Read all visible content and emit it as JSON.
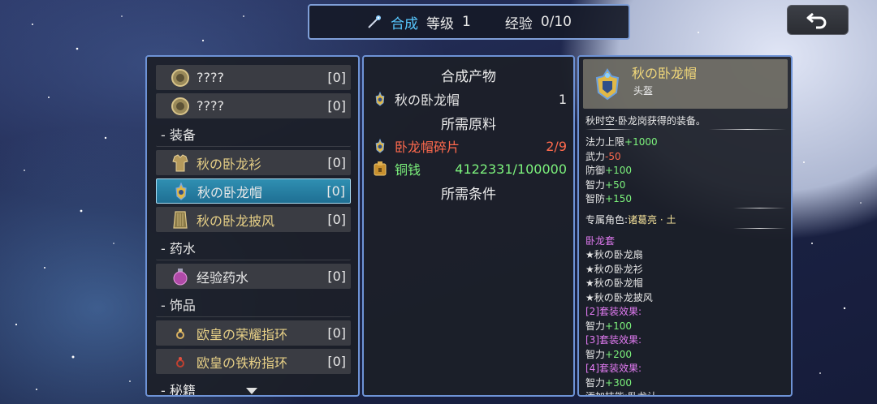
{
  "header": {
    "mode": "合成",
    "level_label": "等级",
    "level_value": "1",
    "exp_label": "经验",
    "exp_value": "0/10"
  },
  "list": {
    "rows": [
      {
        "kind": "item",
        "name": "????",
        "count": "[0]",
        "icon": "gold-coin-icon"
      },
      {
        "kind": "item",
        "name": "????",
        "count": "[0]",
        "icon": "gold-coin-icon"
      },
      {
        "kind": "category",
        "name": "- 装备"
      },
      {
        "kind": "item",
        "name": "秋の卧龙衫",
        "count": "[0]",
        "icon": "armor-icon"
      },
      {
        "kind": "item",
        "name": "秋の卧龙帽",
        "count": "[0]",
        "icon": "helmet-icon",
        "selected": true
      },
      {
        "kind": "item",
        "name": "秋の卧龙披风",
        "count": "[0]",
        "icon": "cape-icon"
      },
      {
        "kind": "category",
        "name": "- 药水"
      },
      {
        "kind": "item",
        "name": "经验药水",
        "count": "[0]",
        "icon": "potion-icon"
      },
      {
        "kind": "category",
        "name": "- 饰品"
      },
      {
        "kind": "item",
        "name": "欧皇の荣耀指环",
        "count": "[0]",
        "icon": "ring-icon"
      },
      {
        "kind": "item",
        "name": "欧皇の铁粉指环",
        "count": "[0]",
        "icon": "red-ring-icon"
      },
      {
        "kind": "category",
        "name": "- 秘籍"
      }
    ]
  },
  "craft": {
    "product_header": "合成产物",
    "product_name": "秋の卧龙帽",
    "product_qty": "1",
    "materials_header": "所需原料",
    "material_name": "卧龙帽碎片",
    "material_qty": "2/9",
    "money_name": "铜钱",
    "money_value": "4122331/100000",
    "conditions_header": "所需条件"
  },
  "detail": {
    "name": "秋の卧龙帽",
    "type": "头盔",
    "desc": "秋时空·卧龙岗获得的装备。",
    "stats": [
      {
        "label": "法力上限",
        "value": "+1000",
        "color": "green"
      },
      {
        "label": "武力",
        "value": "-50",
        "color": "red"
      },
      {
        "label": "防御",
        "value": "+100",
        "color": "green"
      },
      {
        "label": "智力",
        "value": "+50",
        "color": "green"
      },
      {
        "label": "智防",
        "value": "+150",
        "color": "green"
      }
    ],
    "exclusive_label": "专属角色:",
    "exclusive_value": "诸葛亮 · 土",
    "set_name": "卧龙套",
    "set_items": [
      "★秋の卧龙扇",
      "★秋の卧龙衫",
      "★秋の卧龙帽",
      "★秋の卧龙披风"
    ],
    "set_bonuses": [
      {
        "label": "[2]套装效果:",
        "stat": "智力",
        "value": "+100"
      },
      {
        "label": "[3]套装效果:",
        "stat": "智力",
        "value": "+200"
      },
      {
        "label": "[4]套装效果:",
        "stat": "智力",
        "value": "+300"
      }
    ],
    "trailing": "添加技能:卧龙认"
  },
  "colors": {
    "accent": "#58c8ff",
    "panel_border": "#6e93d6",
    "item_gold": "#e6cf86",
    "stat_green": "#7cf27c",
    "stat_red": "#ff6a4d",
    "set_violet": "#e27bf2"
  }
}
